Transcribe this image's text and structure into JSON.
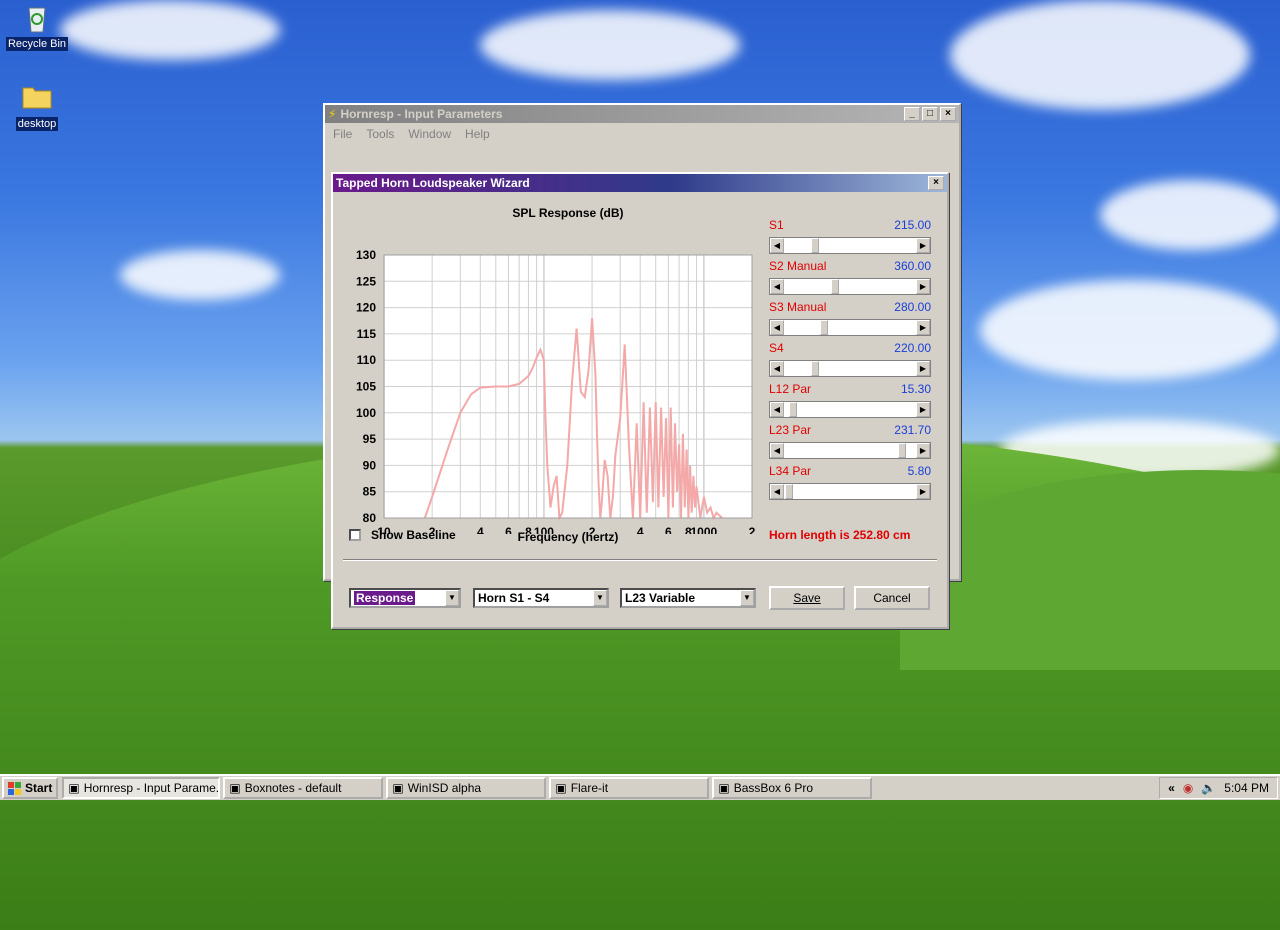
{
  "desktop": {
    "icons": [
      {
        "label": "Recycle Bin"
      },
      {
        "label": "desktop"
      }
    ]
  },
  "main_window": {
    "title": "Hornresp - Input Parameters",
    "menu": [
      "File",
      "Tools",
      "Window",
      "Help"
    ]
  },
  "wizard": {
    "title": "Tapped Horn Loudspeaker Wizard",
    "chart_title": "SPL Response (dB)",
    "show_baseline_label": "Show Baseline",
    "show_baseline_checked": false,
    "x_axis_label": "Frequency (hertz)",
    "horn_length_text": "Horn length is 252.80 cm",
    "sliders": [
      {
        "name": "S1",
        "value": "215.00",
        "position": 0.22
      },
      {
        "name": "S2  Manual",
        "value": "360.00",
        "position": 0.38
      },
      {
        "name": "S3  Manual",
        "value": "280.00",
        "position": 0.29
      },
      {
        "name": "S4",
        "value": "220.00",
        "position": 0.22
      },
      {
        "name": "L12  Par",
        "value": "15.30",
        "position": 0.04
      },
      {
        "name": "L23  Par",
        "value": "231.70",
        "position": 0.92
      },
      {
        "name": "L34  Par",
        "value": "5.80",
        "position": 0.01
      }
    ],
    "combo_response": "Response",
    "combo_horn": "Horn S1 - S4",
    "combo_variable": "L23 Variable",
    "save_label": "Save",
    "cancel_label": "Cancel"
  },
  "taskbar": {
    "start_label": "Start",
    "tasks": [
      {
        "label": "Hornresp - Input Parame...",
        "active": true
      },
      {
        "label": "Boxnotes - default",
        "active": false
      },
      {
        "label": "WinISD alpha",
        "active": false
      },
      {
        "label": "Flare-it",
        "active": false
      },
      {
        "label": "BassBox 6 Pro",
        "active": false
      }
    ],
    "tray_expand": "«",
    "clock": "5:04 PM"
  },
  "chart_data": {
    "type": "line",
    "title": "SPL Response (dB)",
    "xlabel": "Frequency (hertz)",
    "ylabel": "",
    "x_scale": "log",
    "xlim": [
      10,
      2000
    ],
    "ylim": [
      80,
      130
    ],
    "yticks": [
      130,
      125,
      120,
      115,
      110,
      105,
      100,
      95,
      90,
      85,
      80
    ],
    "xtick_labels": [
      "10",
      "2",
      "4",
      "6",
      "8",
      "100",
      "2",
      "4",
      "6",
      "8",
      "1000",
      "2"
    ],
    "xtick_values": [
      10,
      20,
      40,
      60,
      80,
      100,
      200,
      400,
      600,
      800,
      1000,
      2000
    ],
    "grid": true,
    "line_color": "#f4a8a8",
    "series": [
      {
        "x": [
          18,
          20,
          25,
          30,
          35,
          40,
          50,
          60,
          70,
          80,
          85,
          90,
          95,
          100,
          102,
          105,
          110,
          115,
          120,
          125,
          130,
          140,
          150,
          160,
          170,
          180,
          190,
          200,
          210,
          215,
          220,
          225,
          230,
          240,
          250,
          260,
          270,
          280,
          300,
          310,
          320,
          340,
          360,
          380,
          400,
          420,
          440,
          460,
          480,
          500,
          520,
          540,
          560,
          580,
          600,
          620,
          640,
          660,
          680,
          700,
          720,
          740,
          760,
          780,
          800,
          820,
          840,
          860,
          880,
          900,
          950,
          1000,
          1050,
          1100,
          1150,
          1200,
          1300
        ],
        "y": [
          80,
          84,
          93,
          100,
          103.5,
          104.8,
          105,
          105,
          105.5,
          107,
          108.5,
          110.5,
          112,
          110,
          100,
          90,
          82,
          86,
          88,
          80,
          81,
          90,
          106,
          116,
          104,
          103,
          108,
          118,
          107,
          95,
          86,
          80,
          83,
          91,
          88,
          80,
          84,
          92,
          99,
          106,
          113,
          94,
          80,
          98,
          80,
          102,
          81,
          101,
          83,
          102,
          82,
          101,
          84,
          99,
          80,
          101,
          82,
          98,
          85,
          94,
          80,
          96,
          82,
          93,
          80,
          90,
          81,
          88,
          82,
          86,
          80,
          84,
          81,
          82,
          80,
          81,
          80
        ]
      }
    ]
  }
}
